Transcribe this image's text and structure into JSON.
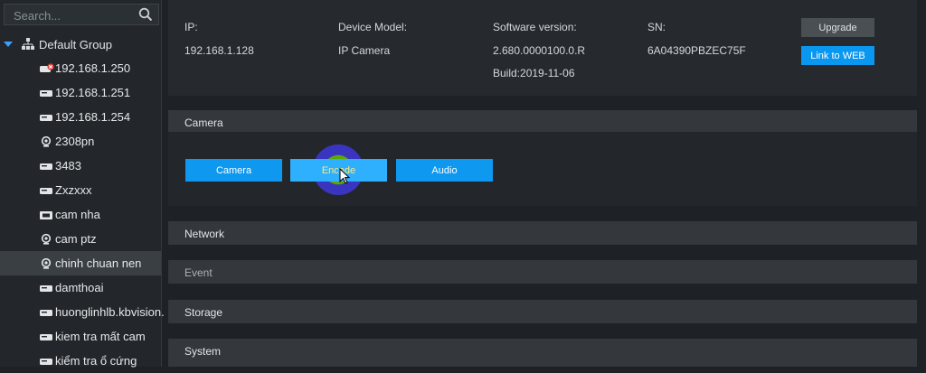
{
  "sidebar": {
    "search_placeholder": "Search...",
    "group_label": "Default Group",
    "items": [
      {
        "label": "192.168.1.250",
        "icon": "camera-offline-icon"
      },
      {
        "label": "192.168.1.251",
        "icon": "nvr-icon"
      },
      {
        "label": "192.168.1.254",
        "icon": "nvr-icon"
      },
      {
        "label": "2308pn",
        "icon": "ip-camera-icon"
      },
      {
        "label": "3483",
        "icon": "nvr-icon"
      },
      {
        "label": "Zxzxxx",
        "icon": "nvr-icon"
      },
      {
        "label": "cam nha",
        "icon": "box-camera-icon"
      },
      {
        "label": "cam ptz",
        "icon": "ip-camera-icon"
      },
      {
        "label": "chinh chuan nen",
        "icon": "ip-camera-icon",
        "selected": true
      },
      {
        "label": "damthoai",
        "icon": "nvr-icon"
      },
      {
        "label": "huonglinhlb.kbvision.",
        "icon": "nvr-icon"
      },
      {
        "label": "kiem tra mất cam",
        "icon": "nvr-icon"
      },
      {
        "label": "kiểm tra ổ cứng",
        "icon": "nvr-icon"
      }
    ]
  },
  "device_info": {
    "ip_label": "IP:",
    "ip_value": "192.168.1.128",
    "model_label": "Device Model:",
    "model_value": "IP Camera",
    "software_label": "Software version:",
    "software_value": "2.680.0000100.0.R",
    "build_value": "Build:2019-11-06",
    "sn_label": "SN:",
    "sn_value": "6A04390PBZEC75F",
    "upgrade_label": "Upgrade",
    "link_web_label": "Link to WEB"
  },
  "sections": {
    "camera": "Camera",
    "network": "Network",
    "event": "Event",
    "storage": "Storage",
    "system": "System"
  },
  "camera_tabs": {
    "camera": "Camera",
    "encode": "Encode",
    "audio": "Audio"
  },
  "colors": {
    "accent": "#0e98ef",
    "panel": "#262a2f",
    "section_header": "#34383d",
    "selected_item": "#3a3f44"
  }
}
